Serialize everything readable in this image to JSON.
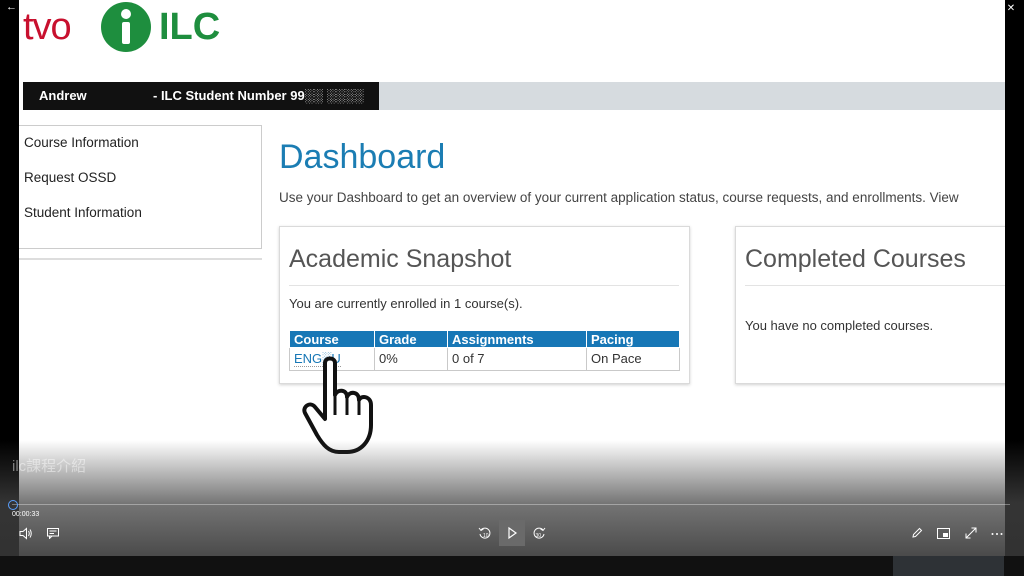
{
  "window": {
    "back_glyph": "←",
    "controls": [
      "–",
      "❐",
      "✕"
    ]
  },
  "logo": {
    "tvo": "tvo",
    "ilc": "ILC"
  },
  "student_bar": {
    "name": "Andrew",
    "number_label": "- ILC Student Number 99░░ ░░░░"
  },
  "sidebar": {
    "items": [
      {
        "label": "Course Information"
      },
      {
        "label": "Request OSSD"
      },
      {
        "label": "Student Information"
      }
    ]
  },
  "dashboard": {
    "title": "Dashboard",
    "intro": "Use your Dashboard to get an overview of your current application status, course requests, and enrollments. View"
  },
  "snapshot": {
    "title": "Academic Snapshot",
    "enrolled_text": "You are currently enrolled in 1 course(s).",
    "columns": [
      "Course",
      "Grade",
      "Assignments",
      "Pacing"
    ],
    "rows": [
      {
        "course": "ENG░U",
        "grade": "0%",
        "assignments": "0 of 7",
        "pacing": "On Pace"
      }
    ]
  },
  "completed": {
    "title": "Completed Courses",
    "empty_text": "You have no completed courses."
  },
  "player": {
    "chapter_title": "ilc課程介紹",
    "timecode": "00:00:33",
    "progress_fraction": 0.0,
    "icons": {
      "volume": "volume-icon",
      "subtitles": "subtitles-icon",
      "skip_back": "skip-back-10-icon",
      "play": "play-icon",
      "skip_forward": "skip-forward-30-icon",
      "edit": "pen-icon",
      "mini_view": "mini-view-icon",
      "fullscreen": "fullscreen-icon",
      "more": "more-icon"
    }
  },
  "colors": {
    "tvo_red": "#c8102e",
    "ilc_green": "#1e8e3e",
    "link_blue": "#1b7db3",
    "table_header": "#1777b6"
  }
}
